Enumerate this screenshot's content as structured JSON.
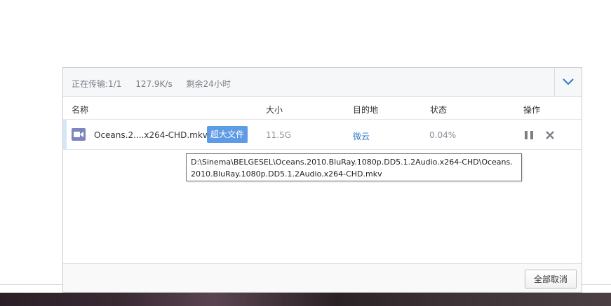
{
  "header": {
    "transferring": "正在传输:1/1",
    "speed": "127.9K/s",
    "remaining": "剩余24小时"
  },
  "columns": {
    "name": "名称",
    "size": "大小",
    "destination": "目的地",
    "status": "状态",
    "actions": "操作"
  },
  "task": {
    "file_name": "Oceans.2....x264-CHD.mkv",
    "badge": "超大文件",
    "size": "11.5G",
    "destination": "微云",
    "status": "0.04%"
  },
  "tooltip": {
    "path": "D:\\Sinema\\BELGESEL\\Oceans.2010.BluRay.1080p.DD5.1.2Audio.x264-CHD\\Oceans.2010.BluRay.1080p.DD5.1.2Audio.x264-CHD.mkv"
  },
  "footer": {
    "cancel_all": "全部取消"
  },
  "icons": {
    "collapse": "chevron-down-icon",
    "file": "video-file-icon",
    "pause": "pause-icon",
    "close": "close-icon"
  },
  "colors": {
    "accent": "#5d9be6",
    "link": "#2f78c4",
    "file_icon": "#7e84c0"
  }
}
